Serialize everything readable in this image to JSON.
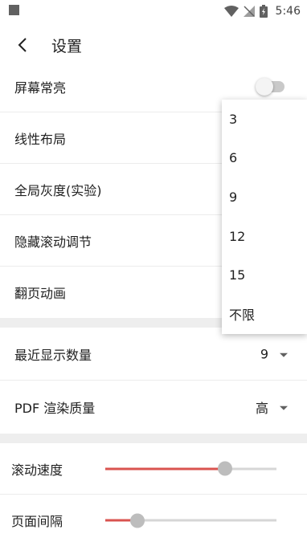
{
  "status_bar": {
    "time": "5:46"
  },
  "page": {
    "title": "设置"
  },
  "settings": {
    "screen_on": {
      "label": "屏幕常亮",
      "enabled": false
    },
    "linear_layout": {
      "label": "线性布局"
    },
    "global_gray": {
      "label": "全局灰度(实验)"
    },
    "hide_scroll": {
      "label": "隐藏滚动调节"
    },
    "page_anim": {
      "label": "翻页动画"
    },
    "recent_count": {
      "label": "最近显示数量",
      "value": "9"
    },
    "pdf_quality": {
      "label": "PDF 渲染质量",
      "value": "高"
    },
    "scroll_speed": {
      "label": "滚动速度",
      "level": 0.7
    },
    "page_spacing": {
      "label": "页面间隔",
      "level": 0.19
    }
  },
  "dropdown": {
    "options": [
      "3",
      "6",
      "9",
      "12",
      "15",
      "不限"
    ]
  },
  "colors": {
    "accent": "#d9534f",
    "section_gap": "#eeeeee"
  }
}
